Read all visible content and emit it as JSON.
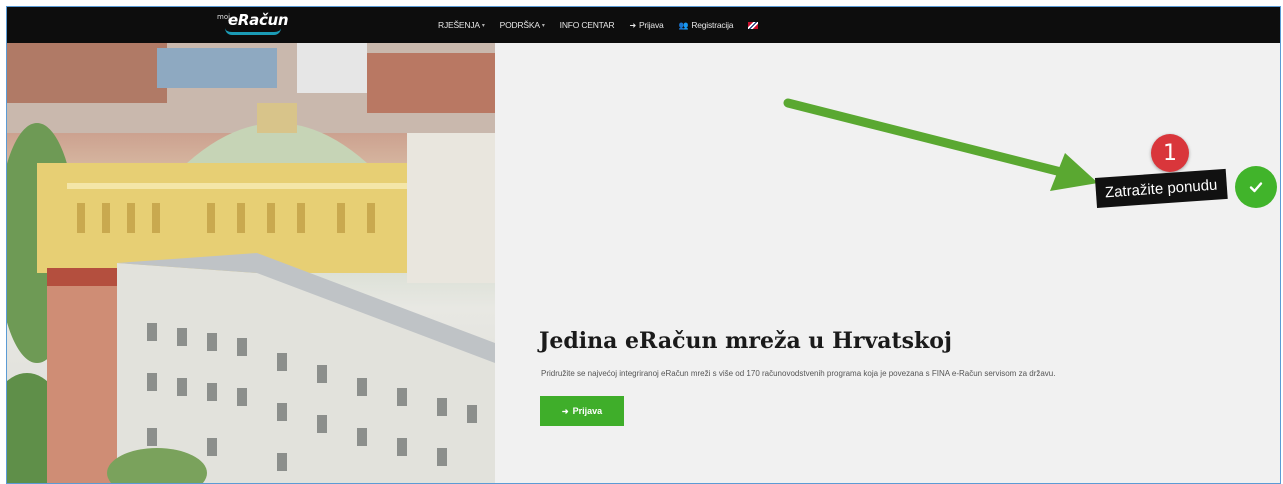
{
  "brand": {
    "prefix": "moj",
    "name": "eRačun"
  },
  "nav": {
    "items": [
      {
        "label": "RJEŠENJA",
        "dropdown": true
      },
      {
        "label": "PODRŠKA",
        "dropdown": true
      },
      {
        "label": "INFO CENTAR",
        "dropdown": false
      },
      {
        "label": "Prijava",
        "icon": "sign-in-icon"
      },
      {
        "label": "Registracija",
        "icon": "users-icon"
      }
    ],
    "language_flag": "uk-flag-icon"
  },
  "hero": {
    "title": "Jedina eRačun mreža u Hrvatskoj",
    "subtitle": "Pridružite se najvećoj integriranoj eRačun mreži s više od 170 računovodstvenih programa koja je povezana s FINA e-Račun servisom za državu.",
    "cta_label": "Prijava"
  },
  "annotation": {
    "step_number": "1",
    "offer_label": "Zatražite ponudu"
  },
  "colors": {
    "accent_green": "#41b42b",
    "nav_bg": "#0d0d0d",
    "badge_red": "#d9363b",
    "arrow_green": "#5aa831"
  }
}
